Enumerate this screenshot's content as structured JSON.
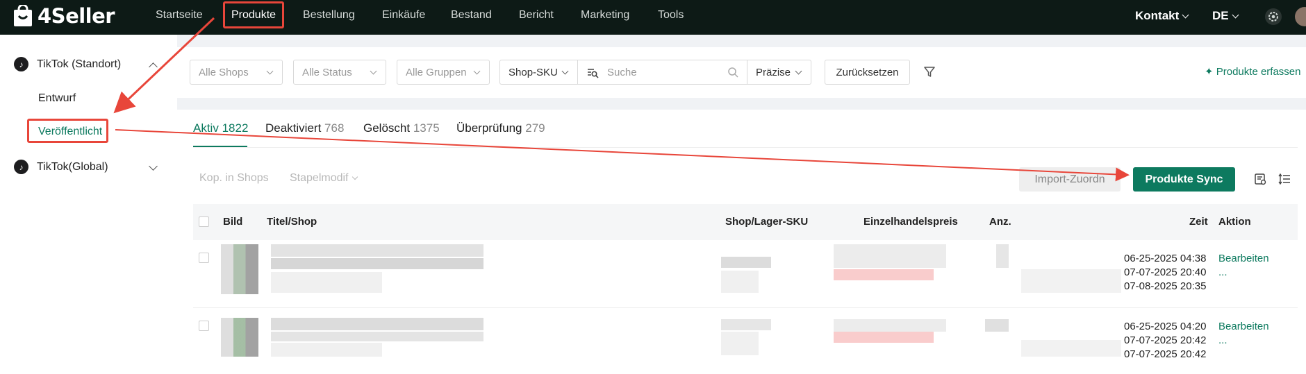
{
  "brand": {
    "name": "4Seller"
  },
  "nav": {
    "items": [
      {
        "label": "Startseite"
      },
      {
        "label": "Produkte"
      },
      {
        "label": "Bestellung"
      },
      {
        "label": "Einkäufe"
      },
      {
        "label": "Bestand"
      },
      {
        "label": "Bericht"
      },
      {
        "label": "Marketing"
      },
      {
        "label": "Tools"
      }
    ],
    "active": "Produkte",
    "contact": "Kontakt",
    "language": "DE"
  },
  "sidebar": {
    "groups": [
      {
        "label": "TikTok (Standort)",
        "expanded": true,
        "items": [
          {
            "label": "Entwurf"
          },
          {
            "label": "Veröffentlicht"
          }
        ]
      },
      {
        "label": "TikTok(Global)",
        "expanded": false
      }
    ],
    "active_item": "Veröffentlicht"
  },
  "filters": {
    "shops": "Alle Shops",
    "status": "Alle Status",
    "groups": "Alle Gruppen",
    "field": "Shop-SKU",
    "search_placeholder": "Suche",
    "match": "Präzise",
    "reset": "Zurücksetzen",
    "capture": "Produkte erfassen"
  },
  "tabs": [
    {
      "label": "Aktiv",
      "count": "1822"
    },
    {
      "label": "Deaktiviert",
      "count": "768"
    },
    {
      "label": "Gelöscht",
      "count": "1375"
    },
    {
      "label": "Überprüfung",
      "count": "279"
    }
  ],
  "toolbar": {
    "copy": "Kop. in Shops",
    "bulk": "Stapelmodif",
    "import": "Import-Zuordn",
    "sync": "Produkte Sync"
  },
  "table": {
    "headers": {
      "image": "Bild",
      "title": "Titel/Shop",
      "sku": "Shop/Lager-SKU",
      "price": "Einzelhandelspreis",
      "qty": "Anz.",
      "time": "Zeit",
      "action": "Aktion"
    },
    "rows": [
      {
        "times": [
          "06-25-2025 04:38",
          "07-07-2025 20:40",
          "07-08-2025 20:35"
        ],
        "action": "Bearbeiten",
        "more": "..."
      },
      {
        "times": [
          "06-25-2025 04:20",
          "07-07-2025 20:42",
          "07-07-2025 20:42"
        ],
        "action": "Bearbeiten",
        "more": "..."
      }
    ]
  },
  "colors": {
    "accent": "#0d7a5f",
    "topbar": "#0d1a16",
    "annotation": "#e8463a"
  }
}
